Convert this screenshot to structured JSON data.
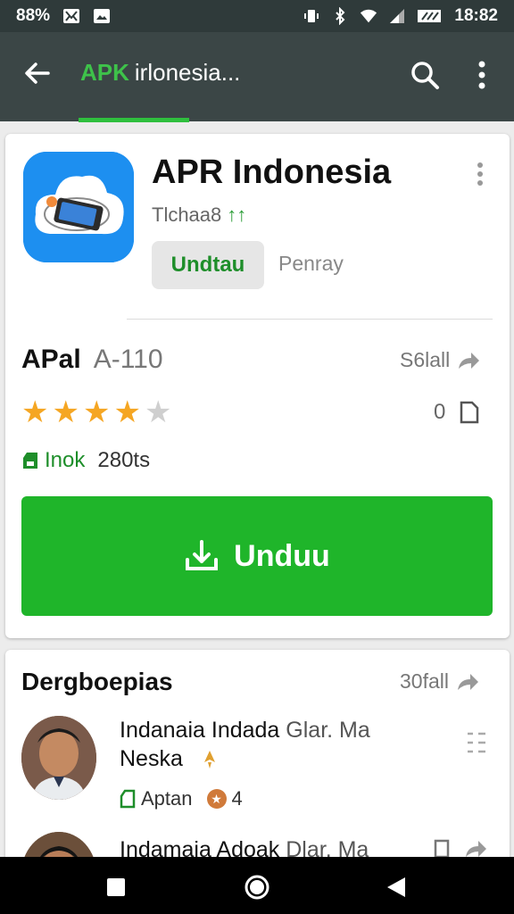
{
  "status_bar": {
    "battery": "88%",
    "time": "18:82",
    "icons": [
      "notification-icon",
      "image-icon",
      "vibrate-icon",
      "bluetooth-icon",
      "wifi-icon",
      "signal-icon",
      "battery-icon"
    ]
  },
  "toolbar": {
    "title_brand": "APK",
    "title_rest": "irlonesia...",
    "brand_color": "#3ec24a",
    "icons": [
      "back-arrow-icon",
      "search-icon",
      "more-vert-icon"
    ]
  },
  "app": {
    "title": "APR Indonesia",
    "developer": "Tlchaa8",
    "developer_mark": "↑↑",
    "chip_primary": "Undtau",
    "chip_secondary": "Penray",
    "version_key": "APal",
    "version_value": "A-110",
    "see_all": "S6lall",
    "rating": 4,
    "rating_max": 5,
    "counter": "0",
    "size_label": "Inok",
    "size_value": "280ts",
    "download_label": "Unduu",
    "accent": "#1fb52a"
  },
  "reviews": {
    "title": "Dergboepias",
    "see_all": "30fall",
    "items": [
      {
        "line1_a": "Indanaia Indada",
        "line1_b": "Glar. Ma",
        "line2": "Neska",
        "meta_label": "Aptan",
        "meta_count": "4"
      },
      {
        "line1_a": "Indamaia Adoak",
        "line1_b": "Dlar. Ma"
      }
    ]
  },
  "nav": {
    "icons": [
      "recents-square-icon",
      "home-circle-icon",
      "back-triangle-icon"
    ]
  }
}
